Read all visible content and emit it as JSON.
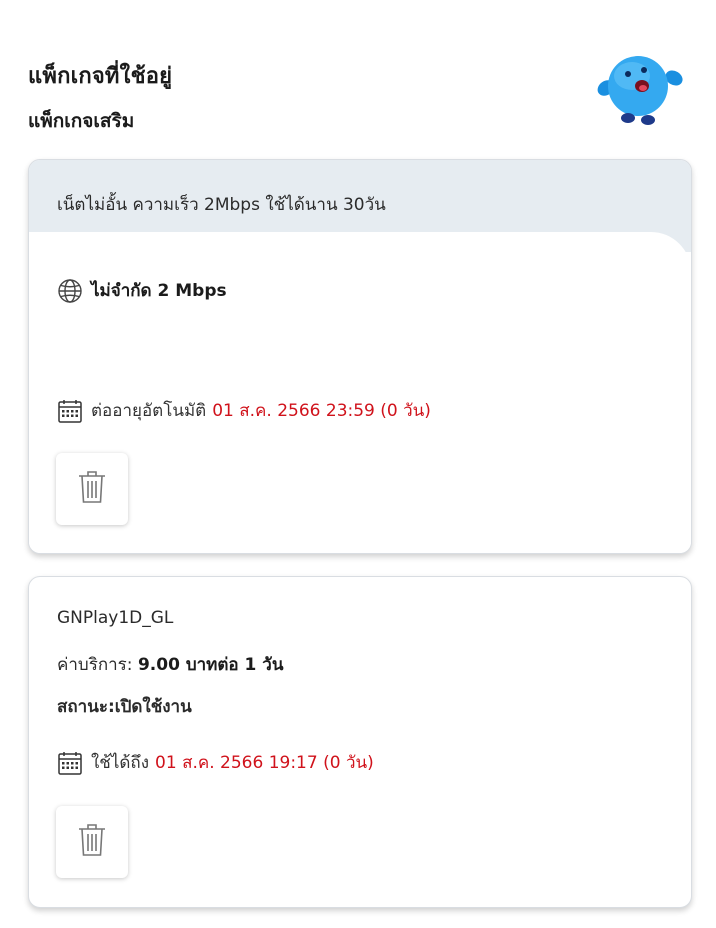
{
  "page": {
    "title": "แพ็กเกจที่ใช้อยู่",
    "subtitle": "แพ็กเกจเสริม"
  },
  "colors": {
    "accent_red": "#d0121b",
    "header_bg": "#e6ecf1"
  },
  "icons": {
    "mascot": "blue-mascot-icon",
    "globe": "globe-icon",
    "calendar": "calendar-icon",
    "trash": "trash-icon"
  },
  "package_1": {
    "header": "เน็ตไม่อั้น ความเร็ว 2Mbps ใช้ได้นาน 30วัน",
    "speed": "ไม่จำกัด 2 Mbps",
    "renew_label": "ต่ออายุอัตโนมัติ",
    "renew_date": "01 ส.ค. 2566 23:59 (0 วัน)"
  },
  "package_2": {
    "name": "GNPlay1D_GL",
    "fee_label": "ค่าบริการ:",
    "fee_value": "9.00 บาทต่อ 1 วัน",
    "status": "สถานะ:เปิดใช้งาน",
    "valid_label": "ใช้ได้ถึง",
    "valid_date": "01 ส.ค. 2566 19:17 (0 วัน)"
  }
}
